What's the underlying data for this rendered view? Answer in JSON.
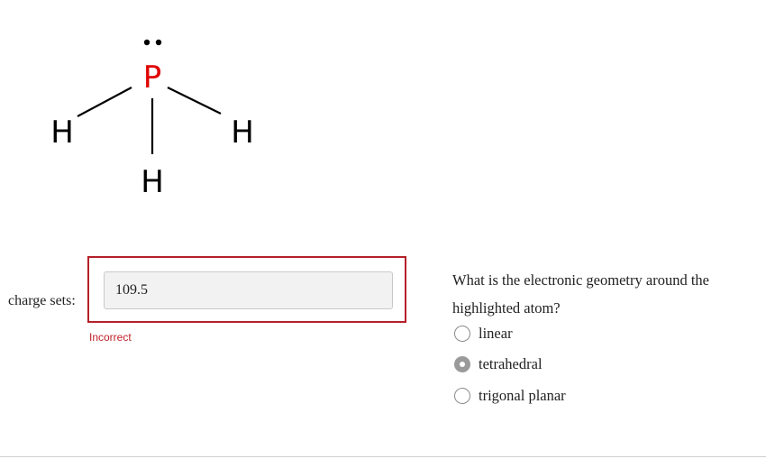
{
  "molecule": {
    "central_atom": "P",
    "substituents": [
      "H",
      "H",
      "H"
    ],
    "central_atom_color": "#e00000",
    "lone_pair_dots": 2
  },
  "form": {
    "label": "charge sets:",
    "value": "109.5",
    "feedback": "Incorrect"
  },
  "question": {
    "text": "What is the electronic geometry around the highlighted atom?",
    "options": [
      {
        "label": "linear",
        "selected": false
      },
      {
        "label": "tetrahedral",
        "selected": true
      },
      {
        "label": "trigonal planar",
        "selected": false
      }
    ]
  },
  "colors": {
    "error": "#b5202a",
    "selected_radio": "#9a9a9a"
  }
}
